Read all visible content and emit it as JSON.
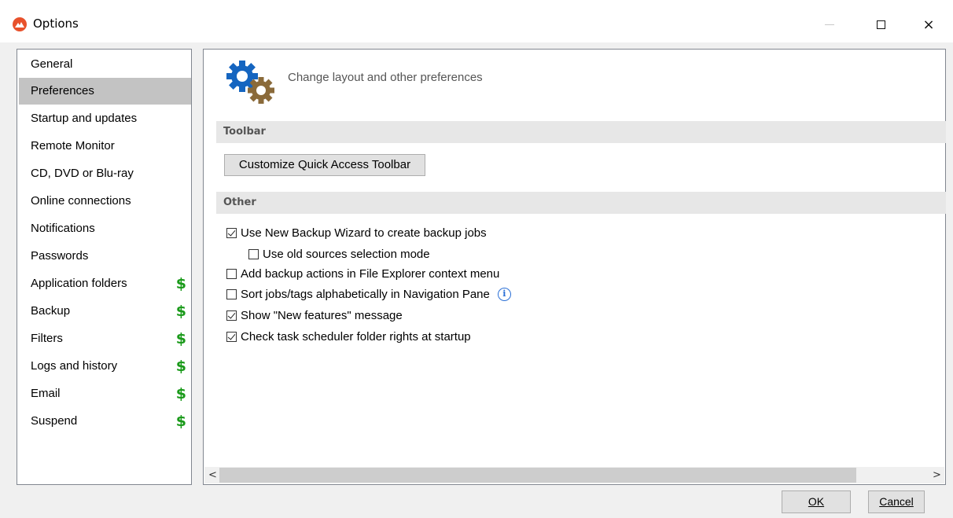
{
  "window": {
    "title": "Options"
  },
  "sidebar": {
    "items": [
      {
        "label": "General",
        "premium": false,
        "selected": false
      },
      {
        "label": "Preferences",
        "premium": false,
        "selected": true
      },
      {
        "label": "Startup and updates",
        "premium": false,
        "selected": false
      },
      {
        "label": "Remote Monitor",
        "premium": false,
        "selected": false
      },
      {
        "label": "CD, DVD or Blu-ray",
        "premium": false,
        "selected": false
      },
      {
        "label": "Online connections",
        "premium": false,
        "selected": false
      },
      {
        "label": "Notifications",
        "premium": false,
        "selected": false
      },
      {
        "label": "Passwords",
        "premium": false,
        "selected": false
      },
      {
        "label": "Application folders",
        "premium": true,
        "selected": false
      },
      {
        "label": "Backup",
        "premium": true,
        "selected": false
      },
      {
        "label": "Filters",
        "premium": true,
        "selected": false
      },
      {
        "label": "Logs and history",
        "premium": true,
        "selected": false
      },
      {
        "label": "Email",
        "premium": true,
        "selected": false
      },
      {
        "label": "Suspend",
        "premium": true,
        "selected": false
      }
    ],
    "premium_symbol": "$",
    "premium_color": "#1a9a1a"
  },
  "content": {
    "heading": "Change layout and other preferences",
    "toolbar_section": {
      "title": "Toolbar",
      "button_label": "Customize Quick Access Toolbar"
    },
    "other_section": {
      "title": "Other",
      "options": [
        {
          "label": "Use New Backup Wizard to create backup jobs",
          "checked": true
        },
        {
          "label": "Use old sources selection mode",
          "checked": false
        },
        {
          "label": "Add backup actions in File Explorer context menu",
          "checked": false
        },
        {
          "label": "Sort jobs/tags alphabetically in Navigation Pane",
          "checked": false
        },
        {
          "label": "Show \"New features\" message",
          "checked": true
        },
        {
          "label": "Check task scheduler folder rights at startup",
          "checked": true
        }
      ],
      "info_icon": "i"
    },
    "scrollbar": {
      "left_arrow": "<",
      "right_arrow": ">"
    }
  },
  "footer": {
    "ok_label": "OK",
    "cancel_label": "Cancel"
  },
  "window_controls": {
    "close_symbol": "×"
  },
  "colors": {
    "accent_icon": "#e8512b",
    "gear_blue": "#1565c0",
    "gear_brown": "#8a6a3a"
  }
}
